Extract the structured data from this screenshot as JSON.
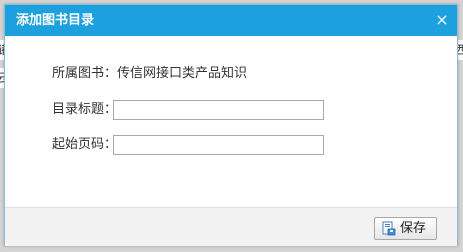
{
  "background": {
    "left_glyph_1": "储",
    "left_glyph_2": "云",
    "right_glyph_1": "西"
  },
  "dialog": {
    "title": "添加图书目录",
    "close_icon": "×",
    "book_label": "所属图书：",
    "book_value": "传信网接口类产品知识",
    "title_label": "目录标题：",
    "title_value": "",
    "page_label": "起始页码：",
    "page_value": "",
    "save_label": "保存"
  },
  "colors": {
    "titlebar": "#1ca0de",
    "footer": "#f2f2f2"
  }
}
